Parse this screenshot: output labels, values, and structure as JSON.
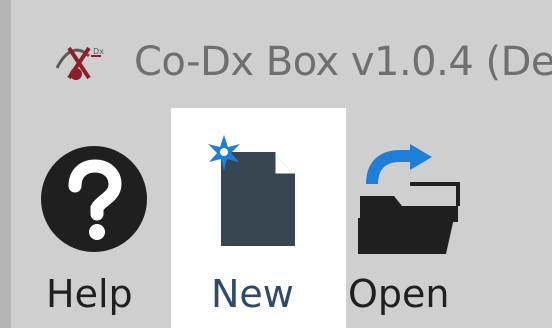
{
  "window": {
    "title": "Co-Dx Box v1.0.4  (De"
  },
  "toolbar": {
    "help_label": "Help",
    "new_label": "New",
    "open_label": "Open"
  },
  "icons": {
    "app": "co-dx-logo-icon",
    "help": "help-question-circle-icon",
    "new": "new-document-sparkle-icon",
    "open": "open-folder-arrow-icon"
  },
  "colors": {
    "background": "#cfcfcf",
    "hover_highlight": "#ffffff",
    "icon_dark": "#374651",
    "accent_blue": "#1f7fd8",
    "logo_red": "#8e1f2a"
  }
}
